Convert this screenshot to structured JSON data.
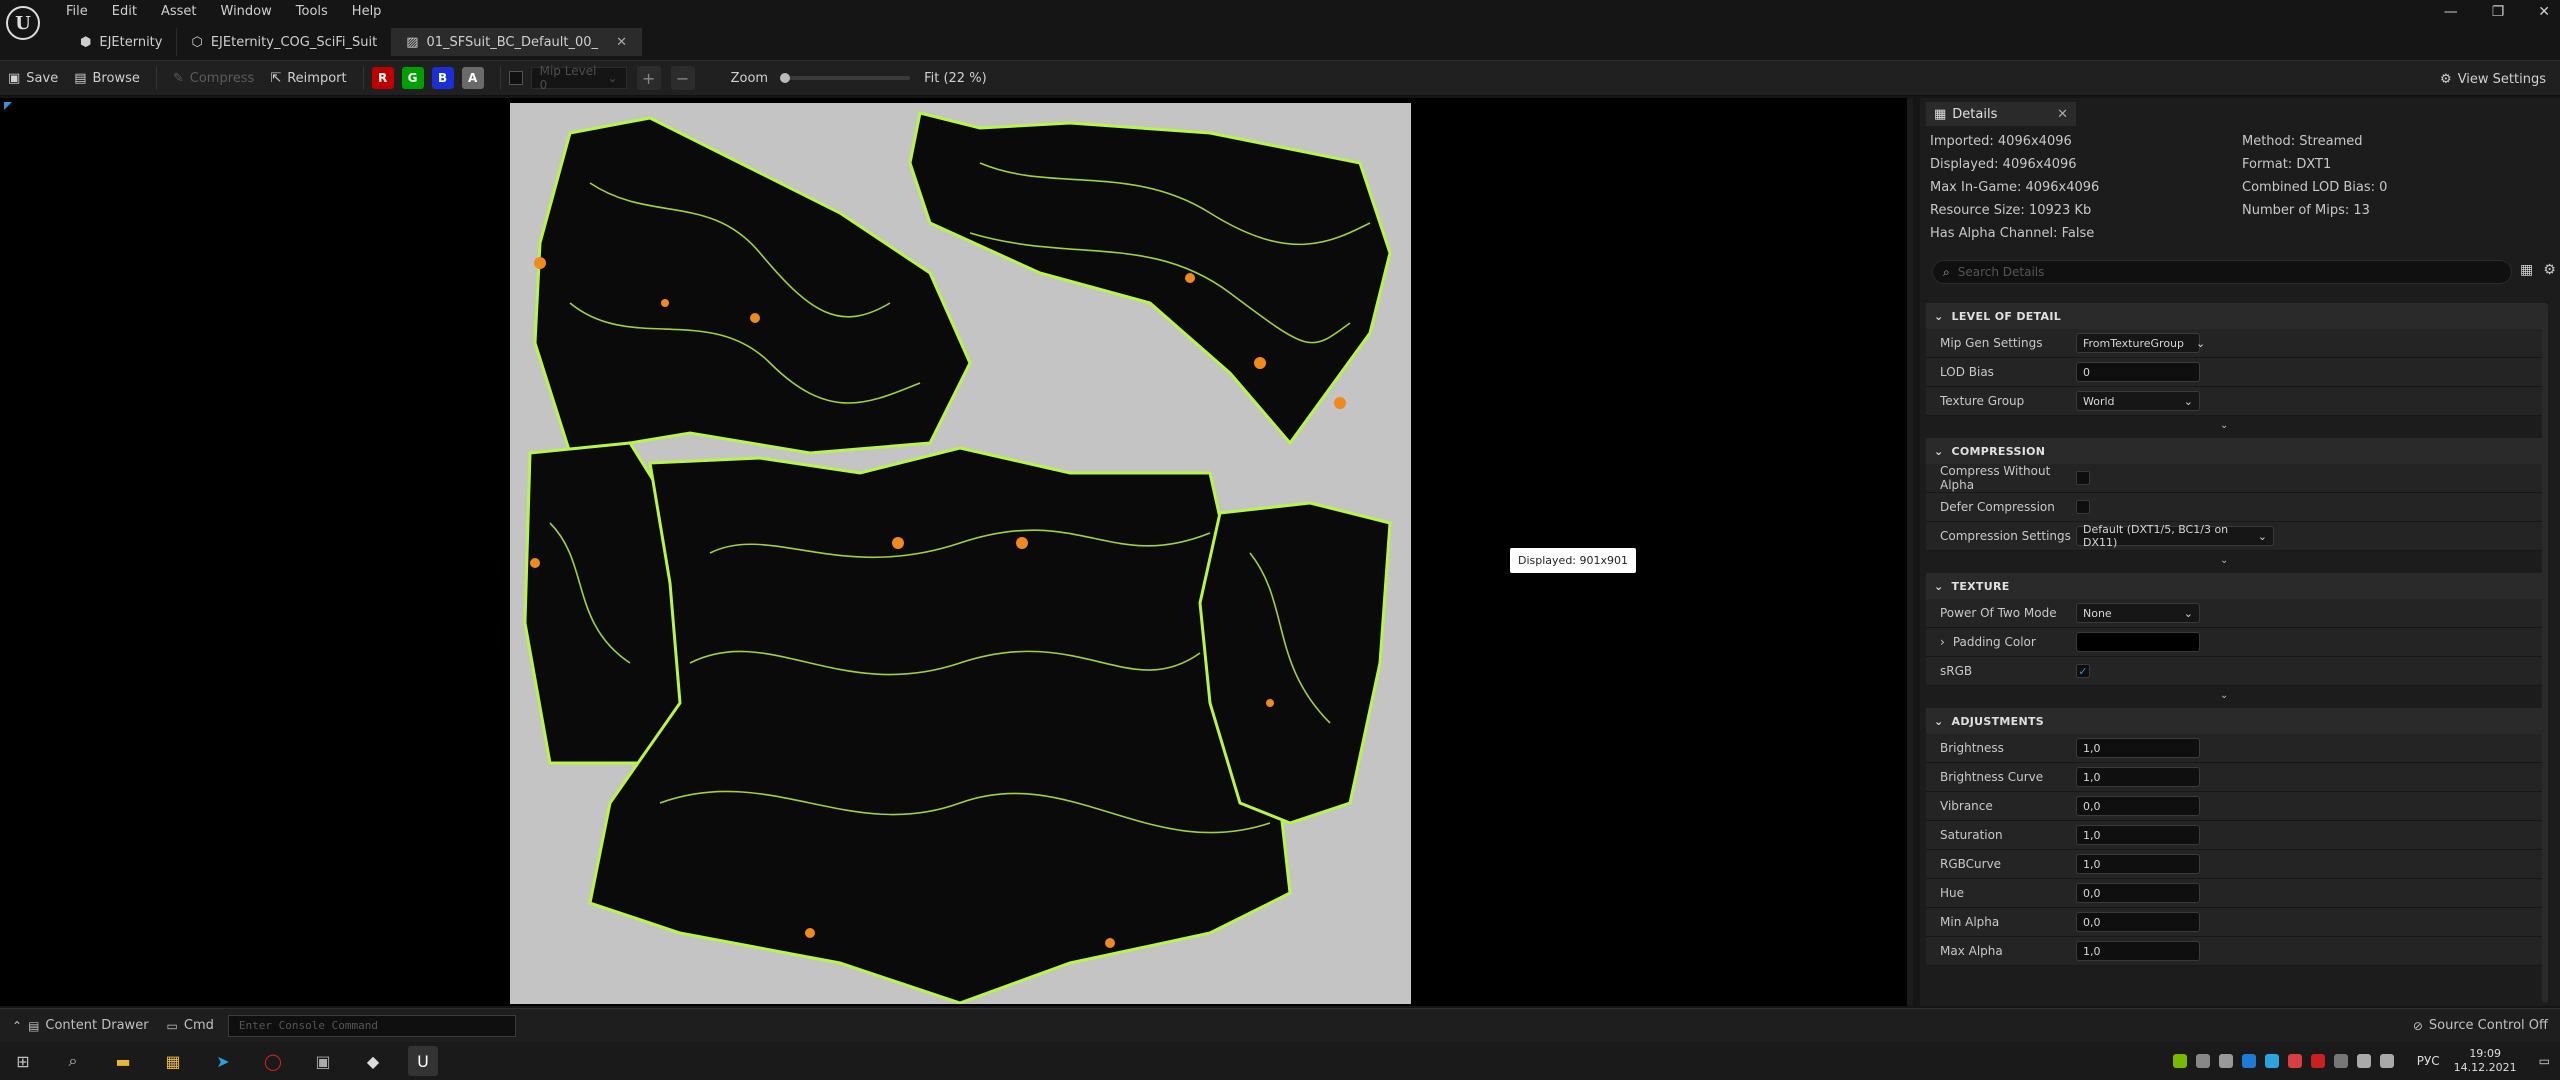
{
  "menu": [
    "File",
    "Edit",
    "Asset",
    "Window",
    "Tools",
    "Help"
  ],
  "tabs": [
    {
      "label": "EJEternity",
      "active": false,
      "closable": false
    },
    {
      "label": "EJEternity_COG_SciFi_Suit",
      "active": false,
      "closable": false
    },
    {
      "label": "01_SFSuit_BC_Default_00_",
      "active": true,
      "closable": true
    }
  ],
  "window_controls": {
    "minimize": "—",
    "maximize": "❐",
    "close": "✕"
  },
  "toolbar": {
    "save": "Save",
    "browse": "Browse",
    "compress": "Compress",
    "reimport": "Reimport",
    "channels": [
      {
        "label": "R",
        "color": "#c00000"
      },
      {
        "label": "G",
        "color": "#00a000"
      },
      {
        "label": "B",
        "color": "#1a2fd6"
      },
      {
        "label": "A",
        "color": "#6a6a6a"
      }
    ],
    "mip_level": "Mip Level 0",
    "zoom_label": "Zoom",
    "zoom_value": 0.0,
    "fit_label": "Fit (22 %)",
    "view_settings": "View Settings"
  },
  "viewport": {
    "tooltip": "Displayed: 901x901",
    "texture_bg": "#c4c4c4",
    "accent": "#b7f54a",
    "orange": "#f08a1c"
  },
  "details": {
    "tab_label": "Details",
    "info_left": [
      "Imported: 4096x4096",
      "Displayed: 4096x4096",
      "Max In-Game: 4096x4096",
      "Resource Size: 10923 Kb",
      "Has Alpha Channel: False"
    ],
    "info_right": [
      "Method: Streamed",
      "Format: DXT1",
      "Combined LOD Bias: 0",
      "Number of Mips: 13"
    ],
    "search_placeholder": "Search Details",
    "sections": {
      "lod": {
        "title": "LEVEL OF DETAIL",
        "mip_gen_label": "Mip Gen Settings",
        "mip_gen_value": "FromTextureGroup",
        "lod_bias_label": "LOD Bias",
        "lod_bias_value": "0",
        "texture_group_label": "Texture Group",
        "texture_group_value": "World"
      },
      "compression": {
        "title": "COMPRESSION",
        "compress_wo_alpha_label": "Compress Without Alpha",
        "compress_wo_alpha": false,
        "defer_label": "Defer Compression",
        "defer": false,
        "settings_label": "Compression Settings",
        "settings_value": "Default (DXT1/5, BC1/3 on DX11)"
      },
      "texture": {
        "title": "TEXTURE",
        "pot_label": "Power Of Two Mode",
        "pot_value": "None",
        "padding_label": "Padding Color",
        "padding_color": "#000000",
        "srgb_label": "sRGB",
        "srgb": true
      },
      "adjustments": {
        "title": "ADJUSTMENTS",
        "rows": [
          {
            "label": "Brightness",
            "value": "1,0"
          },
          {
            "label": "Brightness Curve",
            "value": "1,0"
          },
          {
            "label": "Vibrance",
            "value": "0,0"
          },
          {
            "label": "Saturation",
            "value": "1,0"
          },
          {
            "label": "RGBCurve",
            "value": "1,0"
          },
          {
            "label": "Hue",
            "value": "0,0"
          },
          {
            "label": "Min Alpha",
            "value": "0,0"
          },
          {
            "label": "Max Alpha",
            "value": "1,0"
          }
        ]
      }
    }
  },
  "statusbar": {
    "content_drawer": "Content Drawer",
    "cmd": "Cmd",
    "console_placeholder": "Enter Console Command",
    "source_control": "Source Control Off"
  },
  "taskbar": {
    "time": "19:09",
    "date": "14.12.2021",
    "lang": "РУС"
  }
}
